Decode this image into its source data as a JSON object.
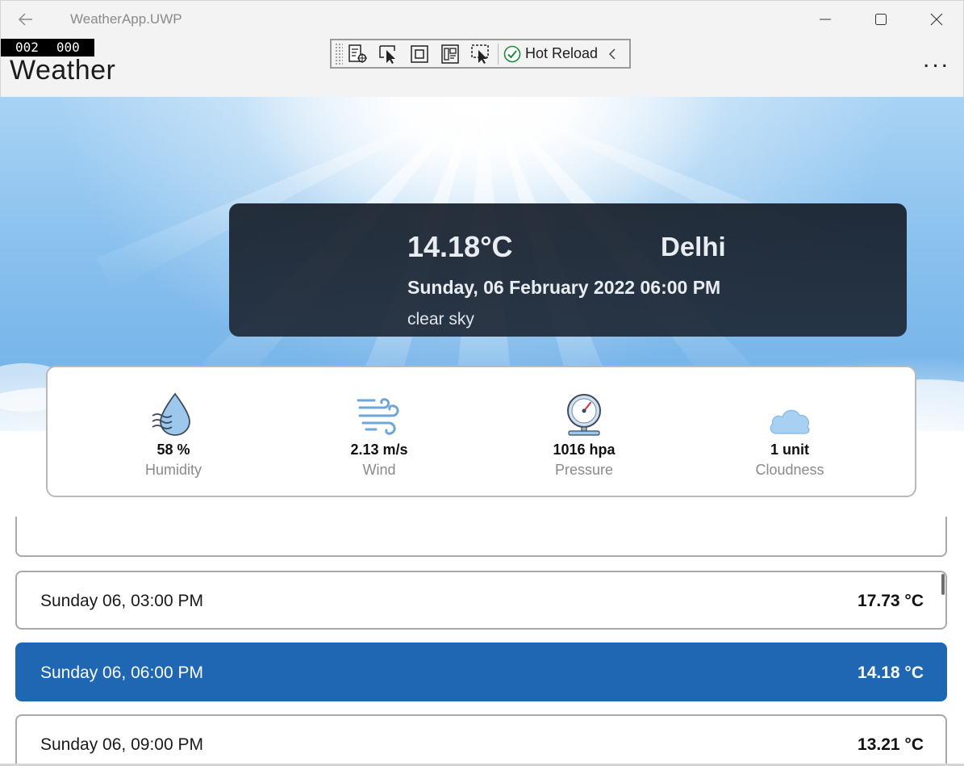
{
  "window": {
    "title": "WeatherApp.UWP"
  },
  "debug_counter": [
    "002",
    "000"
  ],
  "app": {
    "title": "Weather",
    "more_label": "..."
  },
  "debug_toolbar": {
    "hot_reload_label": "Hot Reload"
  },
  "current": {
    "temperature": "14.18°C",
    "city": "Delhi",
    "datetime": "Sunday, 06 February 2022 06:00 PM",
    "description": "clear sky"
  },
  "stats": [
    {
      "value": "58 %",
      "label": "Humidity",
      "icon": "humidity-icon"
    },
    {
      "value": "2.13 m/s",
      "label": "Wind",
      "icon": "wind-icon"
    },
    {
      "value": "1016 hpa",
      "label": "Pressure",
      "icon": "pressure-gauge-icon"
    },
    {
      "value": "1 unit",
      "label": "Cloudness",
      "icon": "cloud-icon"
    }
  ],
  "forecast": [
    {
      "time": "",
      "temp": ""
    },
    {
      "time": "Sunday 06, 03:00 PM",
      "temp": "17.73 °C"
    },
    {
      "time": "Sunday 06, 06:00 PM",
      "temp": "14.18 °C"
    },
    {
      "time": "Sunday 06, 09:00 PM",
      "temp": "13.21 °C"
    }
  ],
  "colors": {
    "selected_row": "#1f67b2",
    "card_dark": "#19212d",
    "sky": "#8cc3ef"
  }
}
